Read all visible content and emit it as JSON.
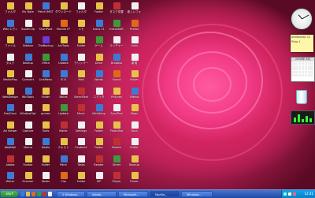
{
  "desktop": {
    "icon_rows": 11,
    "icon_cols": 8,
    "icons": [
      "フォルダ",
      "My Note",
      "Patch IMGT",
      "ダウンロード",
      "フォルダ",
      "Folder",
      "タスク切替",
      "新しいフォ",
      "Wiki エディ",
      "SuperClip",
      "ShortPost",
      "Mozilla FF",
      "メモ",
      "Icons 11",
      "InstallSoft",
      "Firefox",
      "ファイル",
      "Sidebar",
      "TheBackup",
      "ArcTools",
      "Folder",
      "ゲーム",
      "ランチャー",
      "Links",
      "タスク",
      "Backup",
      "Office",
      "Update",
      "クリッパー",
      "Drive",
      "Dropbox",
      "新規",
      "MediaPlay",
      "Comvert",
      "LinkMenu",
      "IE 8",
      "Mail",
      "Words",
      "Sound",
      "Folder",
      "WebDesign",
      "WinTools",
      "Folder",
      "Notes",
      "SelectText",
      "エディタ",
      "Pictures",
      "Videos",
      "FastConv",
      "WindowOpt",
      "gumes",
      "Update",
      "Music",
      "WinSetup",
      "SyncTool",
      "Maps",
      "Ad Viewer",
      "Capture",
      "Tools",
      "Mailer",
      "Settings",
      "Folder",
      "PhotoTool",
      "Docs",
      "WebMail",
      "Memo",
      "Media",
      "テキスト",
      "Ecobuild",
      "Folder",
      "Palette",
      "Editor",
      "Adobe",
      "Foobar",
      "Folder",
      "Paint",
      "Tasks",
      "Reader",
      "Sheet",
      "Backup",
      "Writer",
      "Scanner",
      "Notes",
      "Clip",
      "Folder",
      "ZIP",
      "Player",
      "Finder"
    ],
    "icon_colors": [
      "#e6c24a",
      "#e6c24a",
      "#3b7bd6",
      "#e6c24a",
      "#f0f0f0",
      "#e6c24a",
      "#c03030",
      "#f0f0f0",
      "#3b7bd6",
      "#f0f0f0",
      "#e6c24a",
      "#e06a1a",
      "#e6c24a",
      "#3b7bd6",
      "#3b9b3b",
      "#e06a1a",
      "#e6c24a",
      "#3b7bd6",
      "#6a3bd6",
      "#e6c24a",
      "#e6c24a",
      "#3b9b3b",
      "#f0f0f0",
      "#f0f0f0",
      "#f0f0f0",
      "#3b7bd6",
      "#3b9b3b",
      "#3b7bd6",
      "#f0f0f0",
      "#e6c24a",
      "#3b7bd6",
      "#f0f0f0",
      "#e6c24a",
      "#f0f0f0",
      "#3b7bd6",
      "#3b7bd6",
      "#e6c24a",
      "#3b7bd6",
      "#e06a1a",
      "#e6c24a",
      "#e6c24a",
      "#3b7bd6",
      "#e6c24a",
      "#f0f0f0",
      "#c03030",
      "#f0f0f0",
      "#e6c24a",
      "#3b7bd6",
      "#3b7bd6",
      "#f0f0f0",
      "#e6c24a",
      "#3b9b3b",
      "#c03030",
      "#3b7bd6",
      "#f0f0f0",
      "#e6c24a",
      "#e6c24a",
      "#f0f0f0",
      "#e6c24a",
      "#c03030",
      "#f0f0f0",
      "#e6c24a",
      "#e6c24a",
      "#f0f0f0",
      "#3b7bd6",
      "#f0f0f0",
      "#3b7bd6",
      "#e6c24a",
      "#f0f0f0",
      "#e6c24a",
      "#c03030",
      "#f0f0f0",
      "#c03030",
      "#e6c24a",
      "#e6c24a",
      "#3b7bd6",
      "#f0f0f0",
      "#c03030",
      "#3b9b3b",
      "#e6c24a",
      "#3b7bd6",
      "#e6c24a",
      "#f0f0f0",
      "#e06a1a",
      "#e6c24a",
      "#f0f0f0",
      "#c03030",
      "#e6c24a"
    ]
  },
  "gadgets": {
    "note_lines": [
      "photoshop CS",
      "Pixia 1"
    ],
    "calendar_header": "2008年 8月"
  },
  "taskbar": {
    "start_label": "start",
    "tasks": [
      "2 Windows...",
      "Adobe...",
      "Microsoft...",
      "Mozilla...",
      "Windows..."
    ],
    "clock": "12:41"
  }
}
